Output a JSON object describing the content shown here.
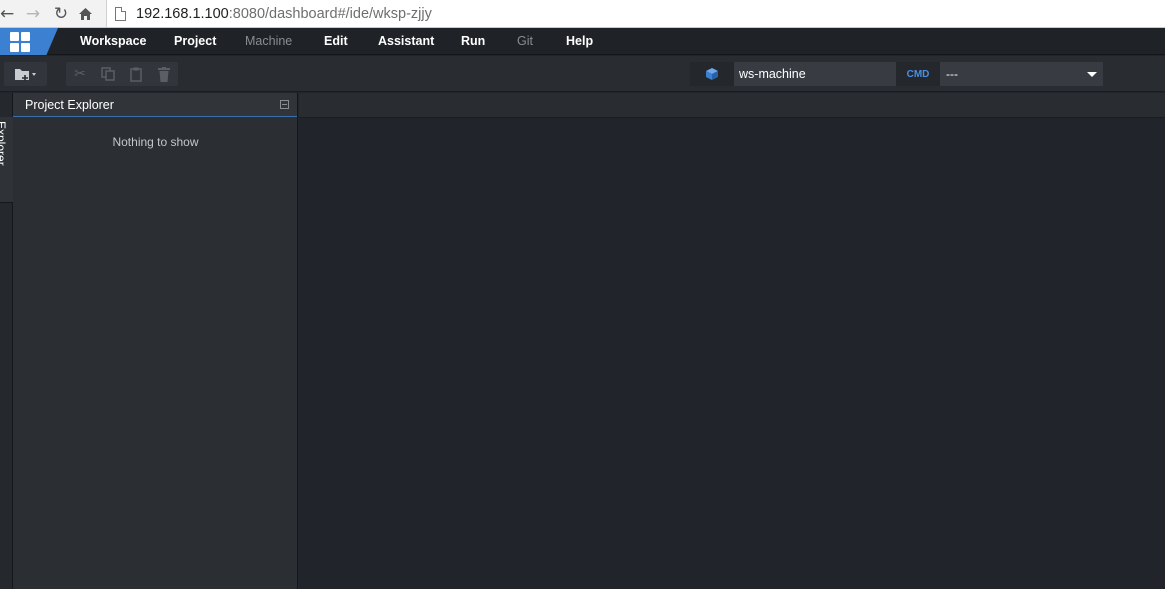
{
  "browser": {
    "url_host": "192.168.1.100",
    "url_path": ":8080/dashboard#/ide/wksp-zjjy"
  },
  "menu": {
    "items": [
      {
        "label": "Workspace",
        "enabled": true
      },
      {
        "label": "Project",
        "enabled": true
      },
      {
        "label": "Machine",
        "enabled": false
      },
      {
        "label": "Edit",
        "enabled": true
      },
      {
        "label": "Assistant",
        "enabled": true
      },
      {
        "label": "Run",
        "enabled": true
      },
      {
        "label": "Git",
        "enabled": false
      },
      {
        "label": "Help",
        "enabled": true
      }
    ]
  },
  "toolbar": {
    "machine_name": "ws-machine",
    "cmd_label": "CMD",
    "cmd_value": "---"
  },
  "side_panel": {
    "tab_label": "Explorer"
  },
  "explorer": {
    "title": "Project Explorer",
    "empty_message": "Nothing to show"
  },
  "colors": {
    "accent": "#3c80d1",
    "background": "#21252b",
    "cmd": "#4b8fe0"
  }
}
